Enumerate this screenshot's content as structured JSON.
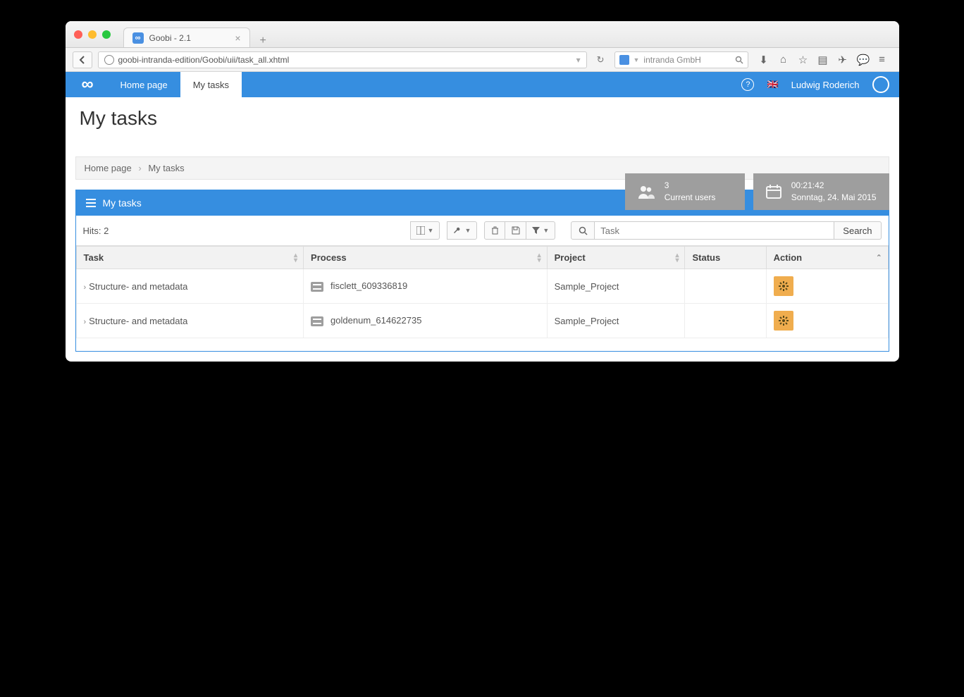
{
  "browser": {
    "tab_title": "Goobi - 2.1",
    "url": "goobi-intranda-edition/Goobi/uii/task_all.xhtml",
    "search_provider": "intranda GmbH"
  },
  "header": {
    "home": "Home page",
    "mytasks": "My tasks",
    "user": "Ludwig Roderich"
  },
  "status_cards": {
    "users_count": "3",
    "users_label": "Current users",
    "time": "00:21:42",
    "date": "Sonntag, 24. Mai 2015"
  },
  "page": {
    "title": "My tasks",
    "breadcrumb_home": "Home page",
    "breadcrumb_current": "My tasks"
  },
  "panel": {
    "title": "My tasks",
    "hits": "Hits: 2",
    "search_placeholder": "Task",
    "search_button": "Search"
  },
  "columns": {
    "task": "Task",
    "process": "Process",
    "project": "Project",
    "status": "Status",
    "action": "Action"
  },
  "rows": [
    {
      "task": "Structure- and metadata",
      "process": "fisclett_609336819",
      "project": "Sample_Project"
    },
    {
      "task": "Structure- and metadata",
      "process": "goldenum_614622735",
      "project": "Sample_Project"
    }
  ]
}
